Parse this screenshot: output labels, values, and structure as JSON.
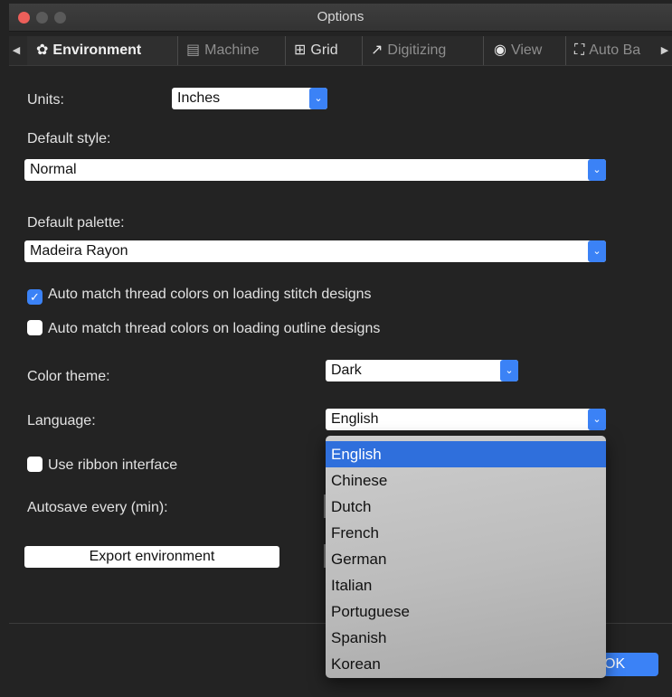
{
  "window": {
    "title": "Options"
  },
  "tabs": [
    {
      "label": "Environment",
      "icon": "gear-icon"
    },
    {
      "label": "Machine",
      "icon": "machine-icon"
    },
    {
      "label": "Grid",
      "icon": "grid-icon"
    },
    {
      "label": "Digitizing",
      "icon": "digitizing-icon"
    },
    {
      "label": "View",
      "icon": "eye-icon"
    },
    {
      "label": "Auto Ba",
      "icon": "frame-icon"
    }
  ],
  "form": {
    "units_label": "Units:",
    "units_value": "Inches",
    "default_style_label": "Default style:",
    "default_style_value": "Normal",
    "default_palette_label": "Default palette:",
    "default_palette_value": "Madeira Rayon",
    "auto_match_stitch_label": "Auto match thread colors on loading stitch designs",
    "auto_match_stitch_checked": true,
    "auto_match_outline_label": "Auto match thread colors on loading outline designs",
    "auto_match_outline_checked": false,
    "color_theme_label": "Color theme:",
    "color_theme_value": "Dark",
    "language_label": "Language:",
    "language_value": "English",
    "ribbon_label": "Use ribbon interface",
    "ribbon_checked": false,
    "autosave_label": "Autosave every (min):",
    "export_button": "Export environment"
  },
  "language_options": [
    "English",
    "Chinese",
    "Dutch",
    "French",
    "German",
    "Italian",
    "Portuguese",
    "Spanish",
    "Korean"
  ],
  "language_selected": "English",
  "footer": {
    "ok_label": "OK"
  },
  "colors": {
    "accent": "#3b82f6",
    "background": "#232323",
    "close": "#ec5f5a"
  }
}
